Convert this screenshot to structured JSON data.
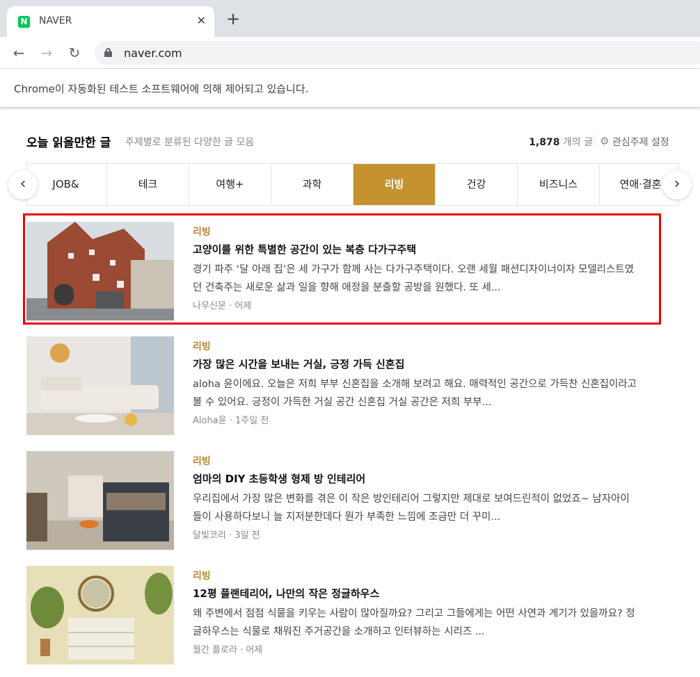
{
  "browser": {
    "tab_title": "NAVER",
    "favicon_letter": "N",
    "url": "naver.com",
    "infobar_text": "Chrome이 자동화된 테스트 소프트웨어에 의해 제어되고 있습니다."
  },
  "section": {
    "title": "오늘 읽을만한 글",
    "subtitle": "주제별로 분류된 다양한 글 모음",
    "count": "1,878",
    "count_suffix": "개의 글",
    "settings_label": "관심주제 설정"
  },
  "categories": [
    {
      "label": "JOB&",
      "active": false
    },
    {
      "label": "테크",
      "active": false
    },
    {
      "label": "여행+",
      "active": false
    },
    {
      "label": "과학",
      "active": false
    },
    {
      "label": "리빙",
      "active": true
    },
    {
      "label": "건강",
      "active": false
    },
    {
      "label": "비즈니스",
      "active": false
    },
    {
      "label": "연애·결혼",
      "active": false
    }
  ],
  "articles": [
    {
      "category": "리빙",
      "title": "고양이를 위한 특별한 공간이 있는 복층 다가구주택",
      "description": "경기 파주 ‘달 아래 집’은 세 가구가 함께 사는 다가구주택이다. 오랜 세월 패션디자이너이자 모델리스트였던 건축주는 새로운 삶과 일을 향해 애정을 분출할 공방을 원했다. 또 세...",
      "source": "나무신문",
      "time": "어제"
    },
    {
      "category": "리빙",
      "title": "가장 많은 시간을 보내는 거실, 긍정 가득 신혼집",
      "description": "aloha 윤이에요. 오늘은 저희 부부 신혼집을 소개해 보려고 해요. 매력적인 공간으로 가득찬 신혼집이라고 볼 수 있어요. 긍정이 가득한 거실 공간 신혼집 거실 공간은 저희 부부...",
      "source": "Aloha윤",
      "time": "1주일 전"
    },
    {
      "category": "리빙",
      "title": "엄마의 DIY 초등학생 형제 방 인테리어",
      "description": "우리집에서 가장 많은 변화를 겪은 이 작은 방인테리어 그렇지만 제대로 보여드린적이 없었죠~ 남자아이들이 사용하다보니 늘 지저분한데다 뭔가 부족한 느낌에 조금만 더 꾸미...",
      "source": "달빛코리",
      "time": "3일 전"
    },
    {
      "category": "리빙",
      "title": "12평 플랜테리어, 나만의 작은 정글하우스",
      "description": "왜 주변에서 점점 식물을 키우는 사람이 많아질까요? 그리고 그들에게는 어떤 사연과 계기가 있을까요? 정글하우스는 식물로 채워진 주거공간을 소개하고 인터뷰하는 시리즈 ...",
      "source": "월간 플로라",
      "time": "어제"
    }
  ],
  "colors": {
    "accent": "#c4932f",
    "category_text": "#b8862d",
    "highlight": "#ee0000"
  }
}
